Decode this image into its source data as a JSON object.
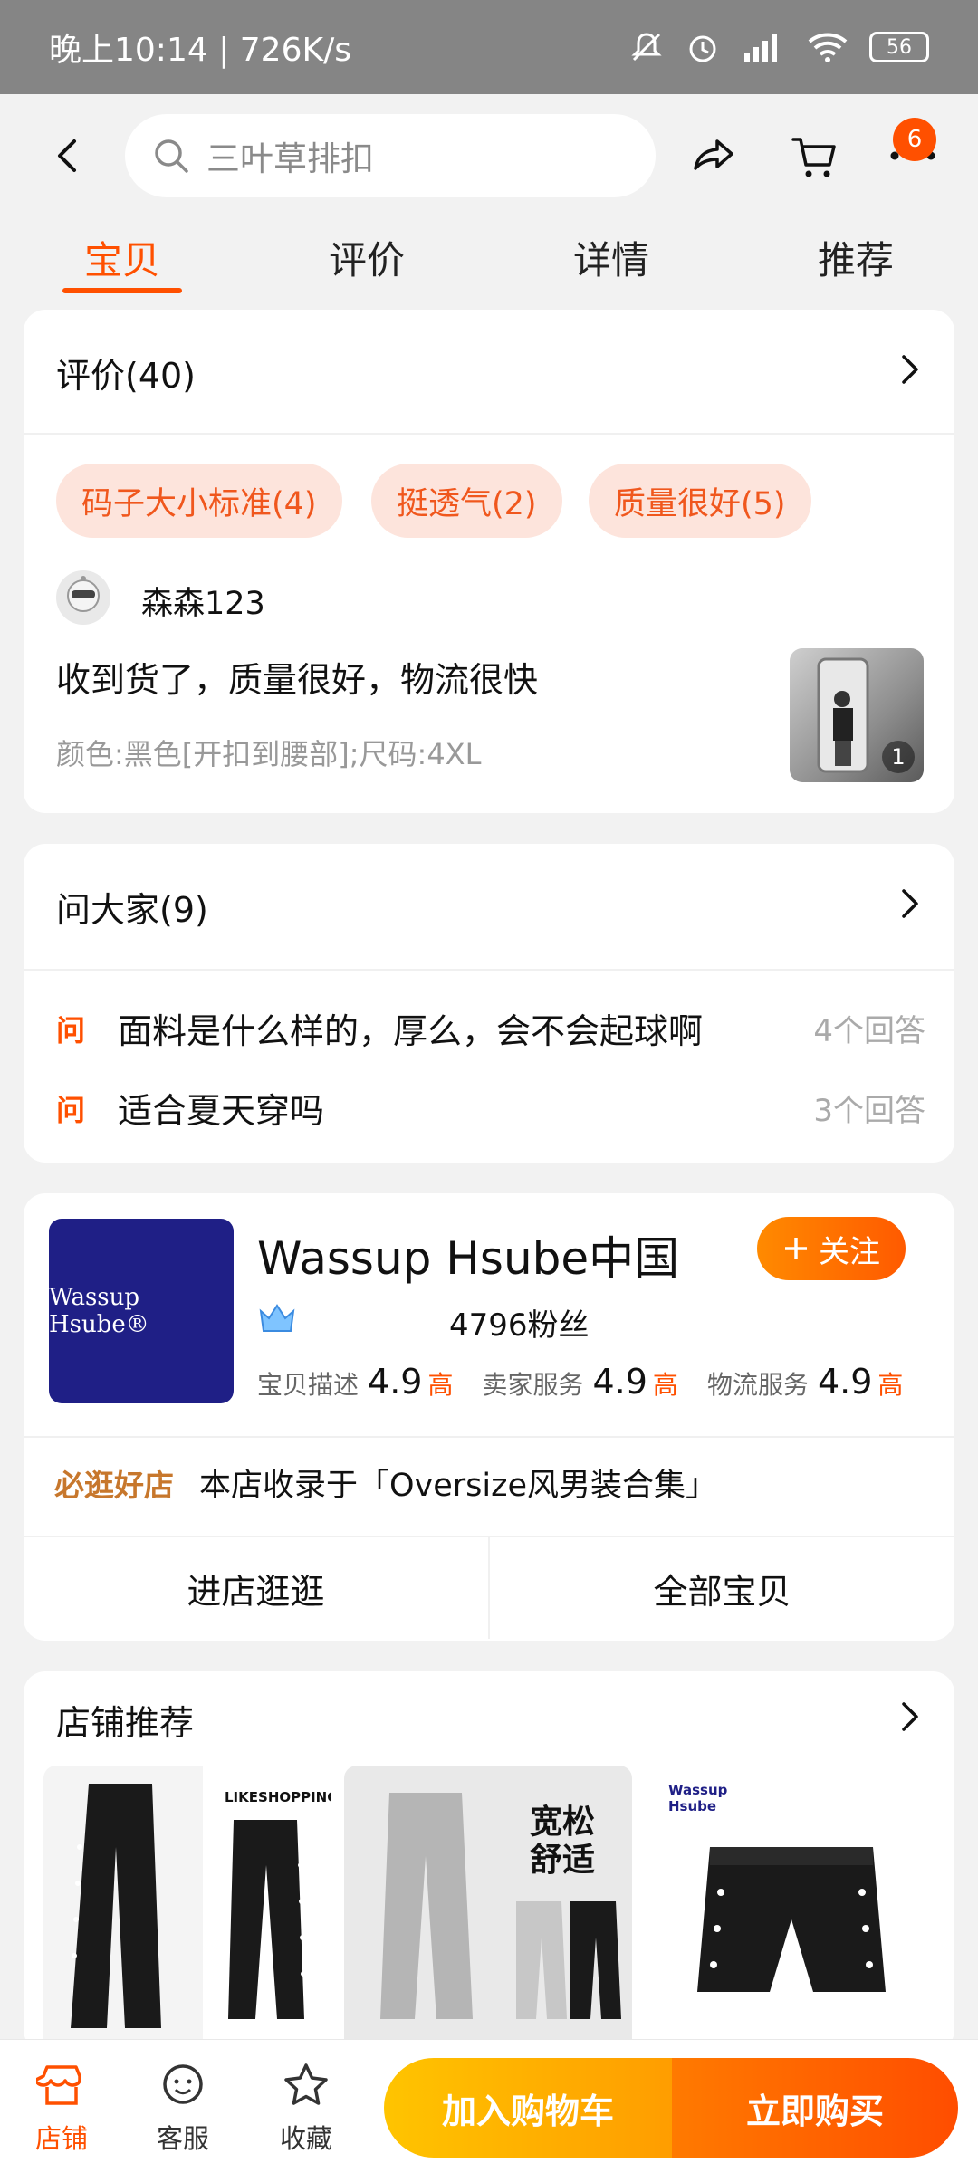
{
  "status_bar": {
    "time_speed": "晚上10:14 | 726K/s",
    "battery": "56"
  },
  "header": {
    "search_placeholder": "三叶草排扣",
    "cart_badge": "6"
  },
  "tabs": [
    {
      "label": "宝贝",
      "active": true
    },
    {
      "label": "评价",
      "active": false
    },
    {
      "label": "详情",
      "active": false
    },
    {
      "label": "推荐",
      "active": false
    }
  ],
  "reviews": {
    "title": "评价(40)",
    "chips": [
      "码子大小标准(4)",
      "挺透气(2)",
      "质量很好(5)"
    ],
    "item": {
      "user": "森森123",
      "text": "收到货了，质量很好，物流很快",
      "sku": "颜色:黑色[开扣到腰部];尺码:4XL",
      "image_count": "1"
    }
  },
  "qa": {
    "title": "问大家(9)",
    "tag": "问",
    "items": [
      {
        "question": "面料是什么样的，厚么，会不会起球啊",
        "answers": "4个回答"
      },
      {
        "question": "适合夏天穿吗",
        "answers": "3个回答"
      }
    ]
  },
  "shop": {
    "logo_text": "Wassup Hsube®",
    "name": "Wassup Hsube中国",
    "follow_label": "关注",
    "fans": "4796粉丝",
    "scores": [
      {
        "label": "宝贝描述",
        "value": "4.9",
        "grade": "高"
      },
      {
        "label": "卖家服务",
        "value": "4.9",
        "grade": "高"
      },
      {
        "label": "物流服务",
        "value": "4.9",
        "grade": "高"
      }
    ],
    "good_shop_label": "必逛好店",
    "collection_text": "本店收录于「Oversize风男装合集」",
    "enter_label": "进店逛逛",
    "all_items_label": "全部宝贝"
  },
  "recommend": {
    "title": "店铺推荐",
    "products": [
      {
        "brand_text": "LIKESHOPPING"
      },
      {
        "tag_text": "宽松舒适"
      },
      {
        "brand_text": "Wassup Hsube"
      }
    ]
  },
  "bottom_bar": {
    "store_label": "店铺",
    "service_label": "客服",
    "favorite_label": "收藏",
    "add_cart_label": "加入购物车",
    "buy_now_label": "立即购买"
  },
  "colors": {
    "accent": "#ff5000",
    "chip_bg": "#fde4dc",
    "shop_logo_bg": "#1f1f86"
  }
}
